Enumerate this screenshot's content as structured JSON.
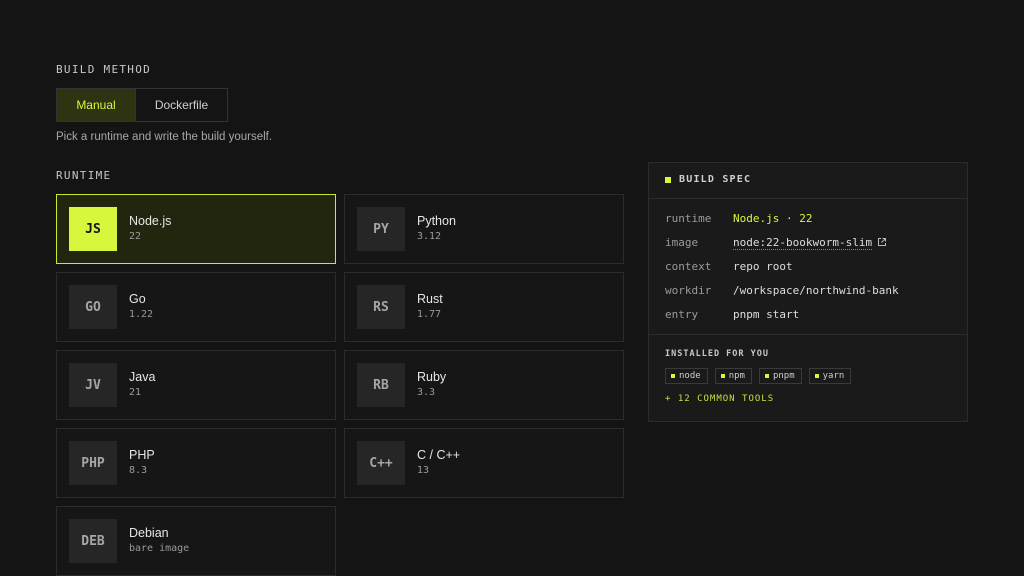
{
  "build_method": {
    "label": "BUILD METHOD",
    "options": [
      "Manual",
      "Dockerfile"
    ],
    "selected": "Manual",
    "hint": "Pick a runtime and write the build yourself."
  },
  "runtime": {
    "label": "RUNTIME",
    "selected": "Node.js",
    "items": [
      {
        "badge": "JS",
        "name": "Node.js",
        "version": "22"
      },
      {
        "badge": "PY",
        "name": "Python",
        "version": "3.12"
      },
      {
        "badge": "GO",
        "name": "Go",
        "version": "1.22"
      },
      {
        "badge": "RS",
        "name": "Rust",
        "version": "1.77"
      },
      {
        "badge": "JV",
        "name": "Java",
        "version": "21"
      },
      {
        "badge": "RB",
        "name": "Ruby",
        "version": "3.3"
      },
      {
        "badge": "PHP",
        "name": "PHP",
        "version": "8.3"
      },
      {
        "badge": "C++",
        "name": "C / C++",
        "version": "13"
      },
      {
        "badge": "DEB",
        "name": "Debian",
        "version": "bare image"
      }
    ]
  },
  "build_spec": {
    "title": "BUILD SPEC",
    "rows": [
      {
        "key": "runtime",
        "value": "Node.js · 22"
      },
      {
        "key": "image",
        "value": "node:22-bookworm-slim"
      },
      {
        "key": "context",
        "value": "repo root"
      },
      {
        "key": "workdir",
        "value": "/workspace/northwind-bank"
      },
      {
        "key": "entry",
        "value": "pnpm start"
      }
    ],
    "installed_label": "INSTALLED FOR YOU",
    "tools": [
      "node",
      "npm",
      "pnpm",
      "yarn"
    ],
    "more_tools": "+ 12 COMMON TOOLS"
  },
  "colors": {
    "background": "#141414",
    "accent": "#d6f73c",
    "selected_fill": "#22260f",
    "border": "#2c2c2c"
  },
  "icons": {
    "external_link": "external-link-icon",
    "spec_marker": "square-bullet-icon"
  }
}
